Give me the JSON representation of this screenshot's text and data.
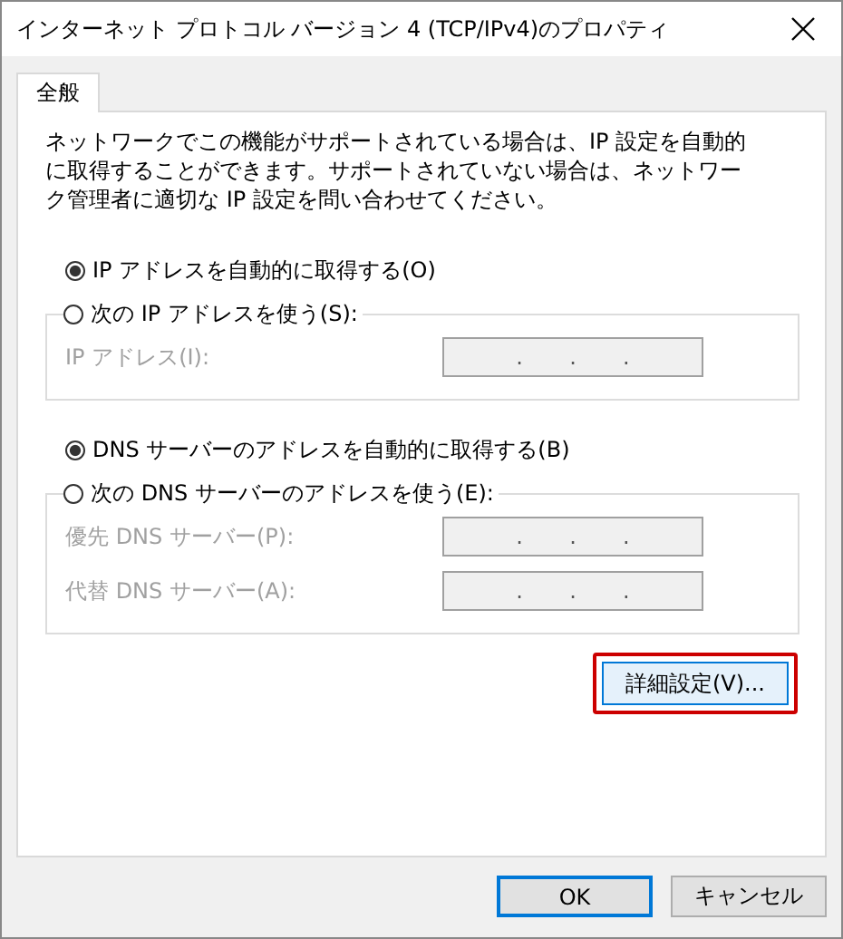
{
  "window": {
    "title": "インターネット プロトコル バージョン 4 (TCP/IPv4)のプロパティ"
  },
  "tabs": [
    {
      "label": "全般",
      "selected": true
    }
  ],
  "description": "ネットワークでこの機能がサポートされている場合は、IP 設定を自動的に取得することができます。サポートされていない場合は、ネットワーク管理者に適切な IP 設定を問い合わせてください。",
  "sections": [
    {
      "options": [
        {
          "label": "IP アドレスを自動的に取得する(O)",
          "selected": true
        },
        {
          "label": "次の IP アドレスを使う(S):",
          "selected": false
        }
      ],
      "fields": [
        {
          "label": "IP アドレス(I):",
          "disabled": true,
          "separators": [
            ".",
            ".",
            "."
          ]
        }
      ]
    },
    {
      "options": [
        {
          "label": "DNS サーバーのアドレスを自動的に取得する(B)",
          "selected": true
        },
        {
          "label": "次の DNS サーバーのアドレスを使う(E):",
          "selected": false
        }
      ],
      "fields": [
        {
          "label": "優先 DNS サーバー(P):",
          "disabled": true,
          "separators": [
            ".",
            ".",
            "."
          ]
        },
        {
          "label": "代替 DNS サーバー(A):",
          "disabled": true,
          "separators": [
            ".",
            ".",
            "."
          ]
        }
      ]
    }
  ],
  "advanced_button": {
    "label": "詳細設定(V)...",
    "highlighted": true
  },
  "buttons": [
    {
      "label": "OK",
      "default": true
    },
    {
      "label": "キャンセル",
      "default": false
    }
  ]
}
